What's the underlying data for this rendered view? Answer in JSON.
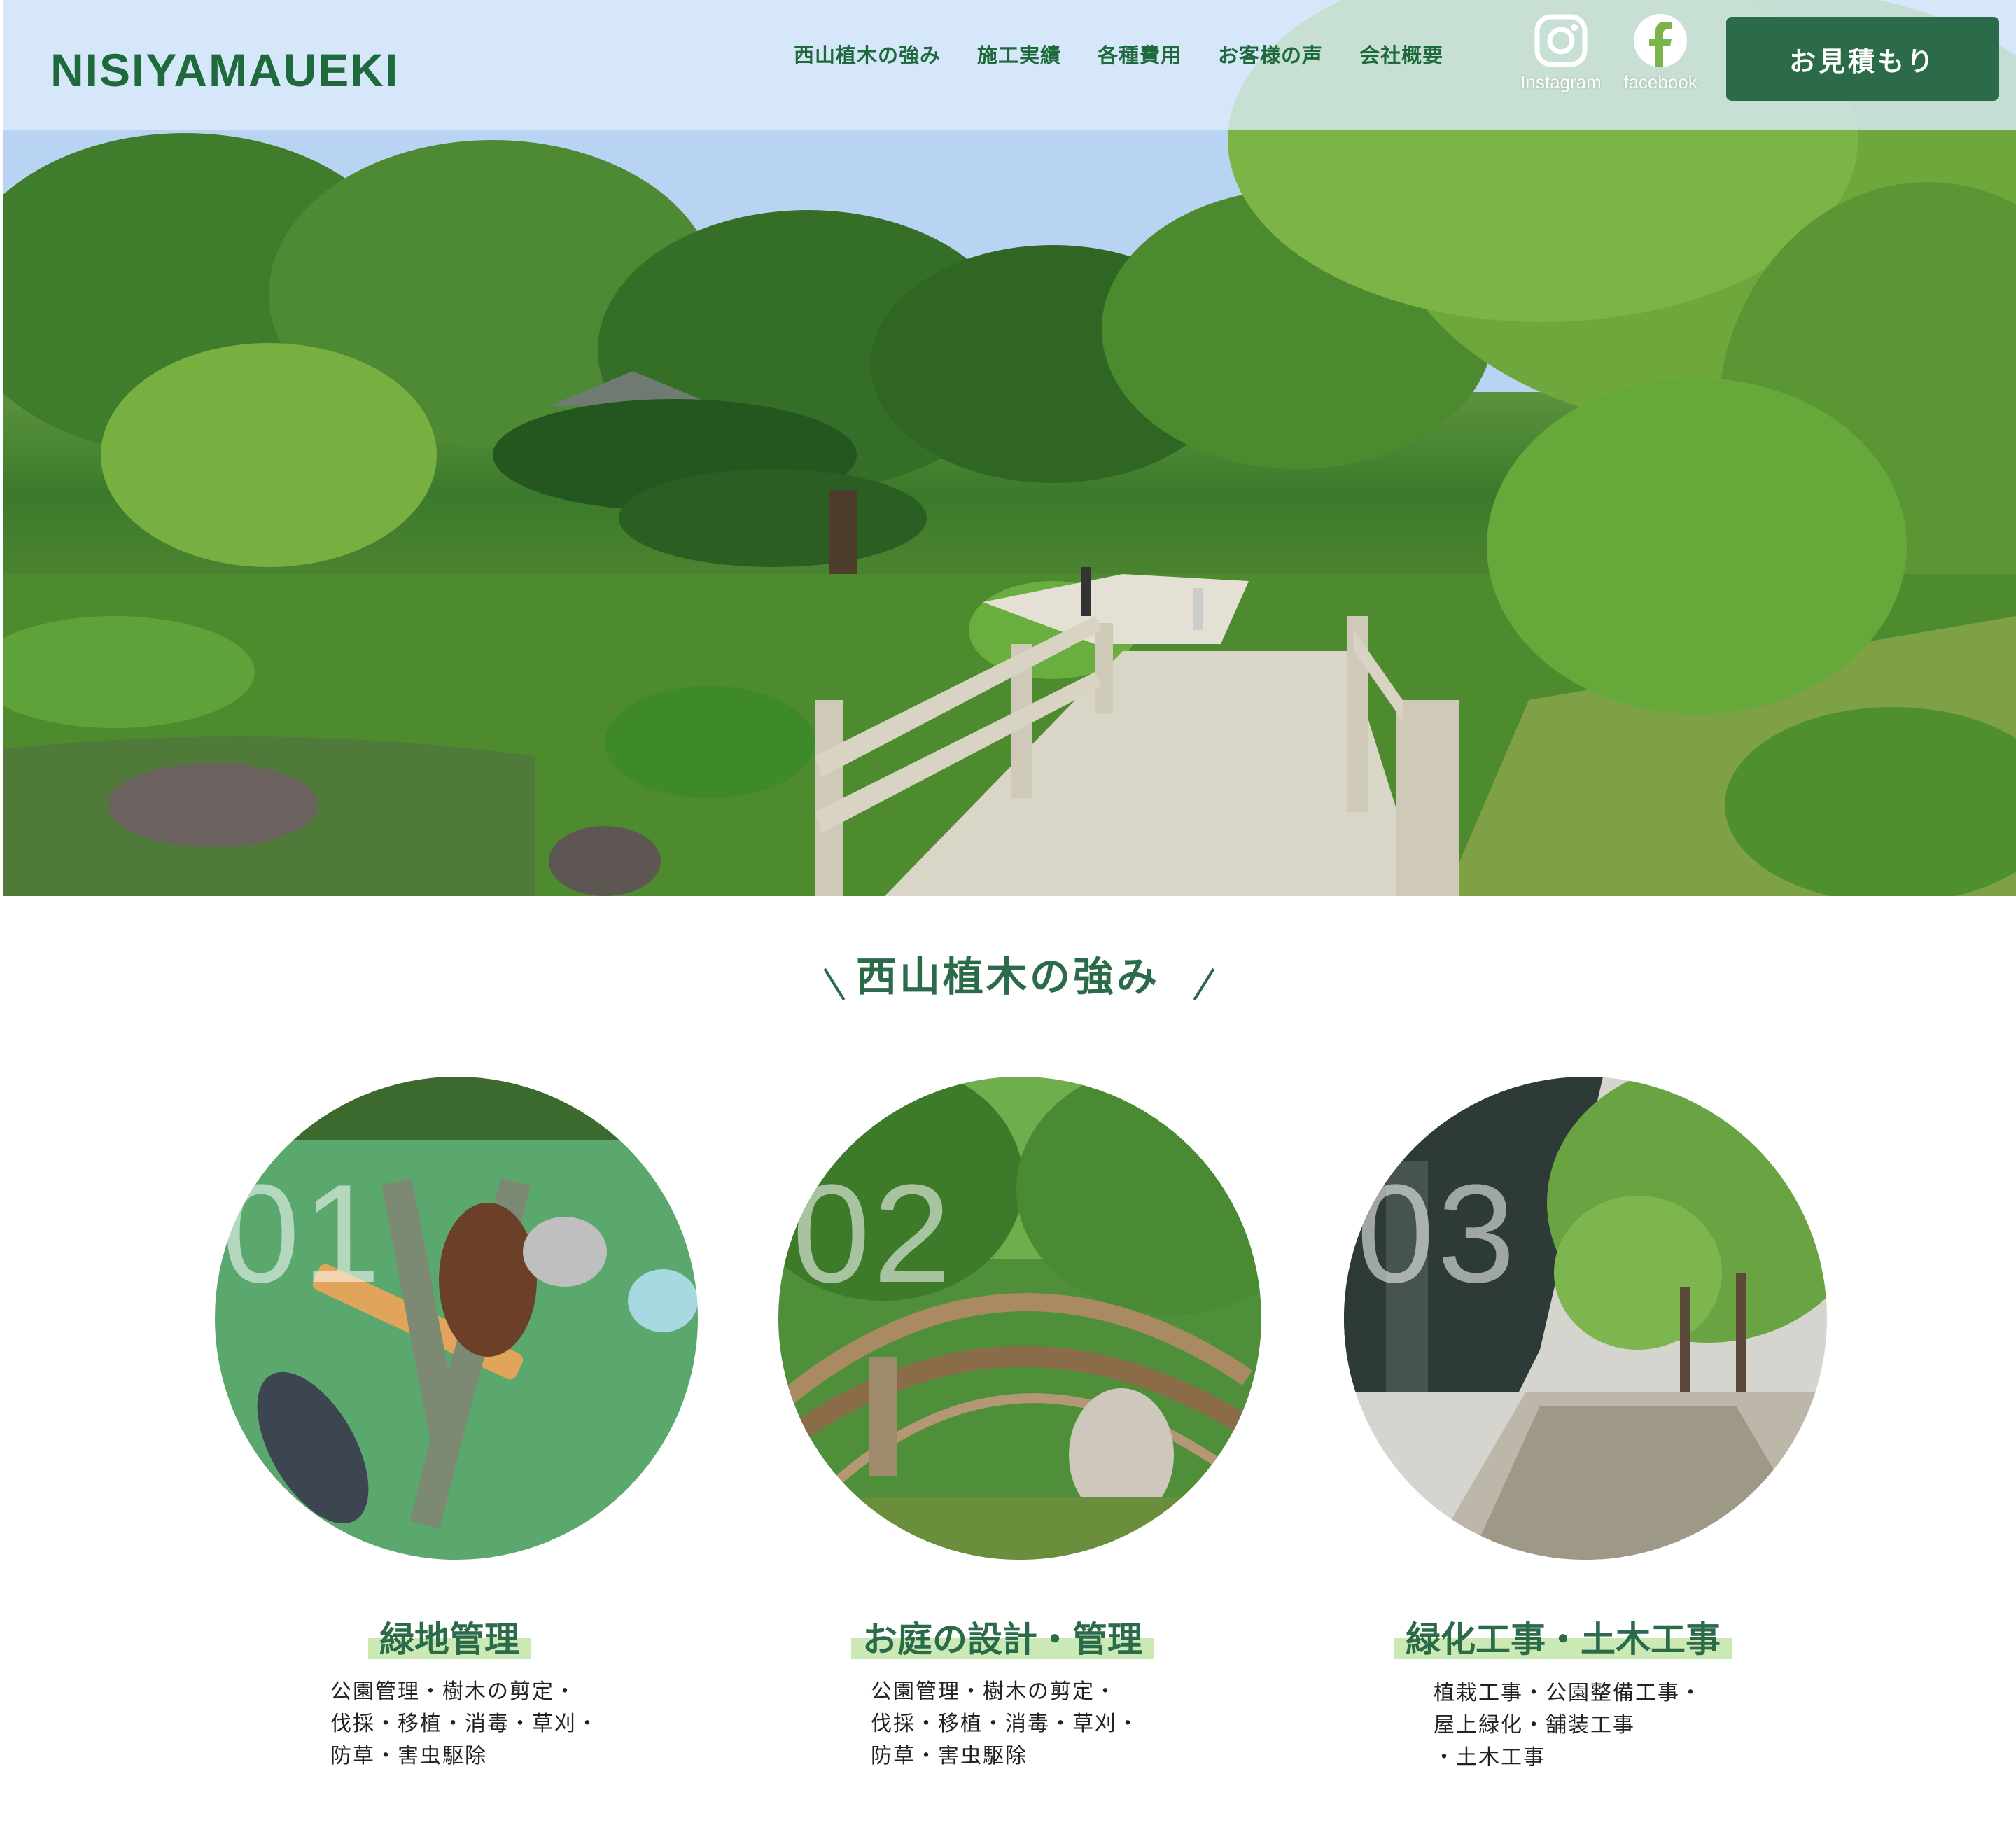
{
  "header": {
    "logo": "NISIYAMAUEKI",
    "nav": [
      "西山植木の強み",
      "施工実績",
      "各種費用",
      "お客様の声",
      "会社概要"
    ],
    "social": [
      {
        "label": "Instagram",
        "icon": "instagram-icon"
      },
      {
        "label": "facebook",
        "icon": "facebook-icon"
      }
    ],
    "cta_label": "お見積もり"
  },
  "colors": {
    "brand_green": "#2b6b4a",
    "logo_green": "#1f6a3c",
    "highlight": "#cbe9b4",
    "header_band": "#dcecfc"
  },
  "hero": {
    "image": "japanese-garden-bridge-photo"
  },
  "strengths": {
    "title": "西山植木の強み",
    "cards": [
      {
        "number": "01",
        "image": "gardening-tools-photo",
        "title": "緑地管理",
        "lines": [
          "公園管理・樹木の剪定・",
          "伐採・移植・消毒・草刈・",
          "防草・害虫駆除"
        ]
      },
      {
        "number": "02",
        "image": "garden-arched-bridge-photo",
        "title": "お庭の設計・管理",
        "lines": [
          "公園管理・樹木の剪定・",
          "伐採・移植・消毒・草刈・",
          "防草・害虫駆除"
        ]
      },
      {
        "number": "03",
        "image": "tree-lined-walkway-photo",
        "title": "緑化工事・土木工事",
        "lines": [
          "植栽工事・公園整備工事・",
          "屋上緑化・舗装工事",
          "・土木工事"
        ]
      }
    ]
  }
}
